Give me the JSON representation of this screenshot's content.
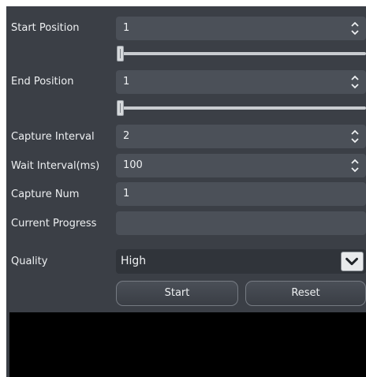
{
  "fields": {
    "start_position": {
      "label": "Start Position",
      "value": "1"
    },
    "start_slider": {
      "fraction": 0.0
    },
    "end_position": {
      "label": "End Position",
      "value": "1"
    },
    "end_slider": {
      "fraction": 0.0
    },
    "capture_interval": {
      "label": "Capture Interval",
      "value": "2"
    },
    "wait_interval": {
      "label": "Wait Interval(ms)",
      "value": "100"
    },
    "capture_num": {
      "label": "Capture Num",
      "value": "1"
    },
    "current_progress": {
      "label": "Current Progress",
      "value": ""
    },
    "quality": {
      "label": "Quality",
      "value": "High"
    }
  },
  "buttons": {
    "start": "Start",
    "reset": "Reset"
  },
  "icons": {
    "spin": "up-down-arrows-icon",
    "dropdown": "chevron-down-icon"
  },
  "colors": {
    "background": "#3b3f46",
    "field": "#4b5058",
    "select": "#30343a",
    "preview": "#000000"
  }
}
